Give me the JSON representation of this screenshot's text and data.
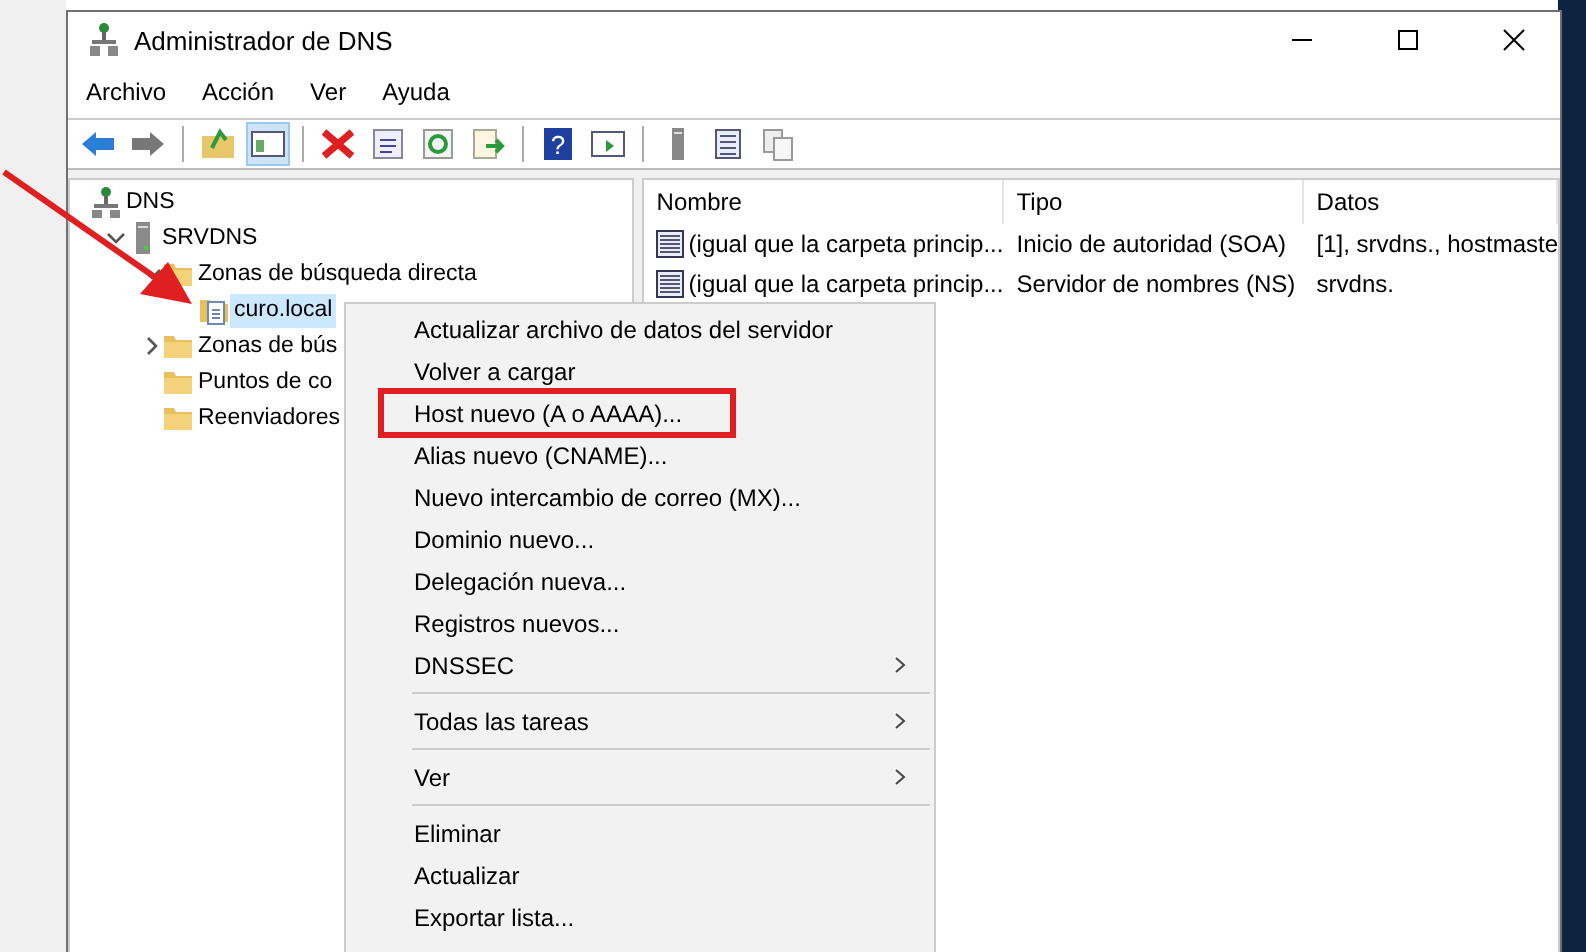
{
  "window": {
    "title": "Administrador de DNS"
  },
  "menu_bar": [
    "Archivo",
    "Acción",
    "Ver",
    "Ayuda"
  ],
  "toolbar": [
    {
      "kind": "back",
      "pressed": false
    },
    {
      "kind": "forward",
      "pressed": false
    },
    {
      "kind": "separator"
    },
    {
      "kind": "up-folder",
      "pressed": false
    },
    {
      "kind": "tree-toggle",
      "pressed": true
    },
    {
      "kind": "separator"
    },
    {
      "kind": "delete",
      "pressed": false
    },
    {
      "kind": "properties",
      "pressed": false
    },
    {
      "kind": "refresh",
      "pressed": false
    },
    {
      "kind": "export",
      "pressed": false
    },
    {
      "kind": "separator"
    },
    {
      "kind": "help",
      "pressed": false,
      "glyph": "?"
    },
    {
      "kind": "pane",
      "pressed": false
    },
    {
      "kind": "separator"
    },
    {
      "kind": "server",
      "pressed": false
    },
    {
      "kind": "list",
      "pressed": false
    },
    {
      "kind": "copy",
      "pressed": false
    }
  ],
  "tree": [
    {
      "label": "DNS",
      "kind": "dns",
      "selected": false,
      "children": [
        {
          "label": "SRVDNS",
          "kind": "server",
          "expanded": true,
          "selected": false,
          "children": [
            {
              "label": "Zonas de búsqueda directa",
              "kind": "folder",
              "expanded": true,
              "selected": false,
              "children": [
                {
                  "label": "curo.local",
                  "kind": "zone",
                  "selected": true
                }
              ]
            },
            {
              "label": "Zonas de bús",
              "kind": "folder",
              "expanded": false,
              "selected": false
            },
            {
              "label": "Puntos de co",
              "kind": "folder",
              "selected": false
            },
            {
              "label": "Reenviadores",
              "kind": "folder",
              "selected": false
            }
          ]
        }
      ]
    }
  ],
  "table": {
    "columns": [
      "Nombre",
      "Tipo",
      "Datos"
    ],
    "rows": [
      {
        "nombre": "(igual que la carpeta princip...",
        "tipo": "Inicio de autoridad (SOA)",
        "datos": "[1], srvdns., hostmaste"
      },
      {
        "nombre": "(igual que la carpeta princip...",
        "tipo": "Servidor de nombres (NS)",
        "datos": "srvdns."
      }
    ]
  },
  "context_menu": [
    {
      "kind": "item",
      "label": "Actualizar archivo de datos del servidor",
      "submenu": false,
      "highlighted": false
    },
    {
      "kind": "item",
      "label": "Volver a cargar",
      "submenu": false,
      "highlighted": false
    },
    {
      "kind": "item",
      "label": "Host nuevo (A o AAAA)...",
      "submenu": false,
      "highlighted": true
    },
    {
      "kind": "item",
      "label": "Alias nuevo (CNAME)...",
      "submenu": false,
      "highlighted": false
    },
    {
      "kind": "item",
      "label": "Nuevo intercambio de correo (MX)...",
      "submenu": false,
      "highlighted": false
    },
    {
      "kind": "item",
      "label": "Dominio nuevo...",
      "submenu": false,
      "highlighted": false
    },
    {
      "kind": "item",
      "label": "Delegación nueva...",
      "submenu": false,
      "highlighted": false
    },
    {
      "kind": "item",
      "label": "Registros nuevos...",
      "submenu": false,
      "highlighted": false
    },
    {
      "kind": "item",
      "label": "DNSSEC",
      "submenu": true,
      "highlighted": false
    },
    {
      "kind": "separator"
    },
    {
      "kind": "item",
      "label": "Todas las tareas",
      "submenu": true,
      "highlighted": false
    },
    {
      "kind": "separator"
    },
    {
      "kind": "item",
      "label": "Ver",
      "submenu": true,
      "highlighted": false
    },
    {
      "kind": "separator"
    },
    {
      "kind": "item",
      "label": "Eliminar",
      "submenu": false,
      "highlighted": false
    },
    {
      "kind": "item",
      "label": "Actualizar",
      "submenu": false,
      "highlighted": false
    },
    {
      "kind": "item",
      "label": "Exportar lista...",
      "submenu": false,
      "highlighted": false
    }
  ]
}
